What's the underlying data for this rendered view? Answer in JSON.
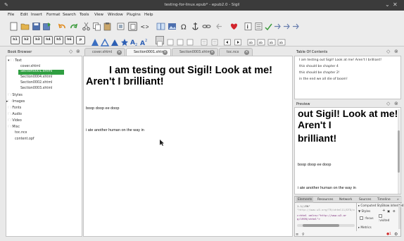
{
  "window": {
    "title": "testing-for-linux.epub* - epub2.0 - Sigil"
  },
  "menu": [
    "File",
    "Edit",
    "Insert",
    "Format",
    "Search",
    "Tools",
    "View",
    "Window",
    "Plugins",
    "Help"
  ],
  "heading_buttons": [
    "h1",
    "h2",
    "h3",
    "h4",
    "h5",
    "h6",
    "p"
  ],
  "book_browser": {
    "title": "Book Browser",
    "folders": {
      "text": "Text",
      "styles": "Styles",
      "images": "Images",
      "fonts": "Fonts",
      "audio": "Audio",
      "video": "Video",
      "misc": "Misc"
    },
    "text_files": [
      "cover.xhtml",
      "Section0001.xhtml",
      "Section0004.xhtml",
      "Section0002.xhtml",
      "Section0003.xhtml"
    ],
    "other_files": [
      "toc.ncx",
      "content.opf"
    ]
  },
  "tabs": [
    "cover.xhtml",
    "Section0001.xhtml",
    "Section0003.xhtml",
    "toc.ncx"
  ],
  "editor": {
    "heading_line1": "I am testing out Sigil! Look at me!",
    "heading_line2": "Aren't I brilliant!",
    "para1": "boop doop ee doop",
    "para2": "i ate another human on the way in"
  },
  "toc": {
    "title": "Table Of Contents",
    "items": [
      "I am testing out Sigil! Look at me! Aren't I brilliant!",
      "this should be chapter 4",
      "this should be chapter 2!",
      "in the end we all die of boom!"
    ]
  },
  "preview": {
    "title": "Preview",
    "line1": "out Sigil! Look at me!",
    "line2": "Aren't I",
    "line3": "brilliant!",
    "para1": "boop doop ee doop",
    "para2": "i ate another human on the way in"
  },
  "inspector": {
    "tabs": [
      "Elements",
      "Resources",
      "Network",
      "Sources",
      "Timeline"
    ],
    "code_line1": "1.1//EN\"",
    "code_line2": "\"http://www.w3.org/TR/xhtml11/DTD/xhtml11.dtd\">",
    "code_html": "▸<html xmlns=\"http://www.w3.or",
    "code_html_end": "g/1999/xhtml\">",
    "computed_style": "▸ Computed Style",
    "show_inherited": "Show inherited",
    "styles": "▼ Styles",
    "focus": ":focus",
    "visited": ":visited",
    "metrics": "▸ Metrics",
    "error_count": "1"
  },
  "colors": {
    "selection": "#2f9e41",
    "titlebar": "#3b3b3b"
  }
}
